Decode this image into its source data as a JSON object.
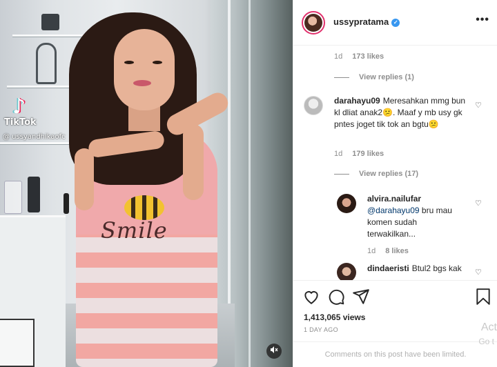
{
  "video": {
    "tiktok_label": "TikTok",
    "tiktok_handle": "@ ussyandhikaofc",
    "shirt_text": "Smile",
    "mute_icon": "speaker-muted-icon"
  },
  "header": {
    "username": "ussypratama",
    "verified_mark": "✓",
    "more_label": "•••"
  },
  "comments": {
    "top": {
      "time": "1d",
      "likes": "173 likes",
      "view_replies": "View replies (1)"
    },
    "c1": {
      "user": "darahayu09",
      "text": "Meresahkan mmg bun kl dliat anak2😕. Maaf y mb usy gk pntes joget tik tok an bgtu😕",
      "time": "1d",
      "likes": "179 likes",
      "view_replies": "View replies (17)"
    },
    "r1": {
      "user": "alvira.nailufar",
      "mention": "@darahayu09",
      "text": "bru mau komen sudah terwakilkan...",
      "time": "1d",
      "likes": "8 likes"
    },
    "r2": {
      "user": "dindaeristi",
      "text": "Btul2 bgs kak"
    }
  },
  "actions": {
    "views": "1,413,065 views",
    "timestamp": "1 DAY AGO",
    "limited": "Comments on this post have been limited."
  },
  "watermark": {
    "line1": "Act",
    "line2": "Go t"
  },
  "colors": {
    "link": "#00376b",
    "muted": "#8e8e8e",
    "verified": "#3897f0"
  }
}
